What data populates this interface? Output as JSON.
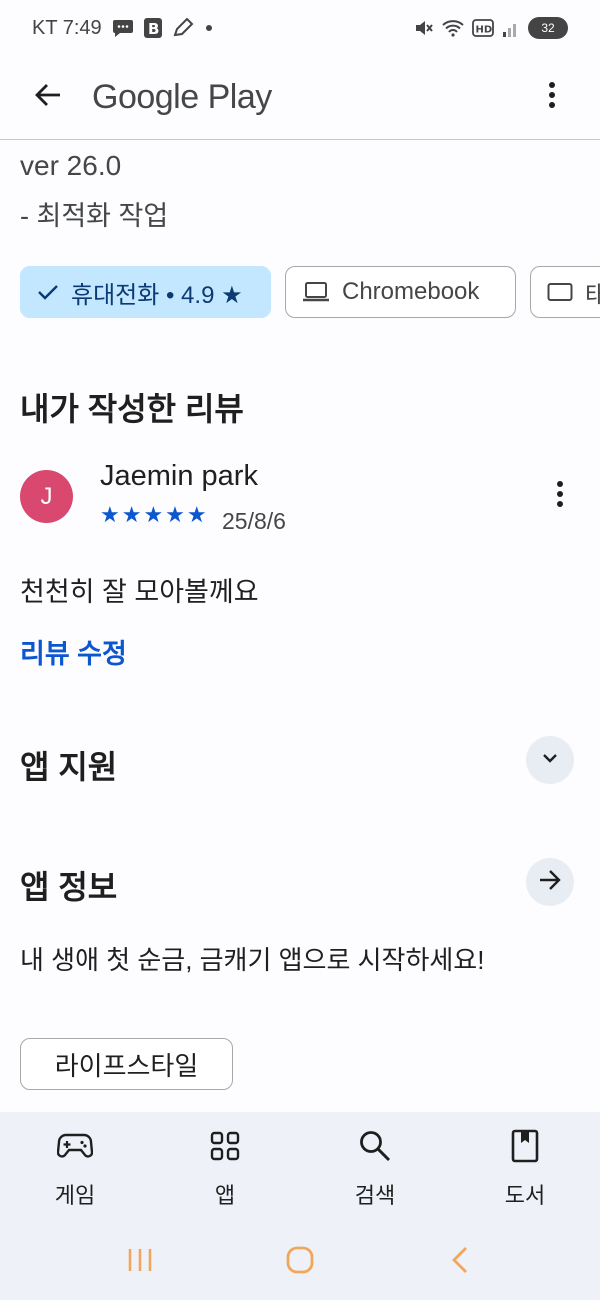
{
  "status_bar": {
    "carrier_time": "KT 7:49",
    "battery": "32"
  },
  "app_bar": {
    "title": "Google Play"
  },
  "whats_new": {
    "version": "ver 26.0",
    "note": "- 최적화 작업"
  },
  "device_chips": [
    {
      "label": "휴대전화 • 4.9 ★",
      "selected": true,
      "icon": "check-icon"
    },
    {
      "label": "Chromebook",
      "selected": false,
      "icon": "laptop-icon"
    },
    {
      "label": "태",
      "selected": false,
      "icon": "tablet-icon"
    }
  ],
  "my_review": {
    "title": "내가 작성한 리뷰",
    "avatar_letter": "J",
    "reviewer": "Jaemin park",
    "stars": "★★★★★",
    "rating": 5,
    "date": "25/8/6",
    "text": "천천히 잘 모아볼께요",
    "edit_label": "리뷰 수정"
  },
  "app_support": {
    "title": "앱 지원"
  },
  "app_info": {
    "title": "앱 정보",
    "description": "내 생애 첫 순금, 금캐기 앱으로 시작하세요!",
    "category": "라이프스타일"
  },
  "bottom_nav": [
    {
      "label": "게임",
      "icon": "gamepad-icon"
    },
    {
      "label": "앱",
      "icon": "apps-grid-icon"
    },
    {
      "label": "검색",
      "icon": "search-icon"
    },
    {
      "label": "도서",
      "icon": "book-icon"
    }
  ],
  "colors": {
    "accent": "#0b57d0",
    "chip_selected_bg": "#c2e7ff",
    "avatar": "#d9486f",
    "nav_bg": "#eef2f8",
    "system_nav": "#f2a65a"
  }
}
